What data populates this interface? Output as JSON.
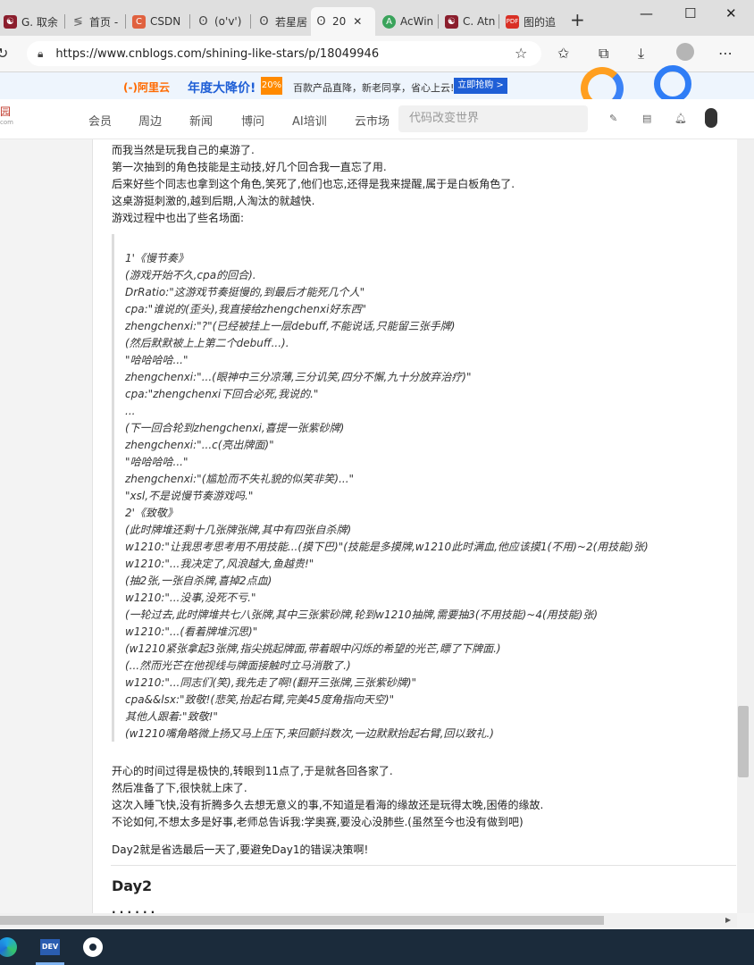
{
  "browser": {
    "tabs": [
      {
        "label": "G. 取余"
      },
      {
        "label": "首页 -"
      },
      {
        "label": "CSDN"
      },
      {
        "label": "(o'v')"
      },
      {
        "label": "若星居"
      },
      {
        "label": "20"
      },
      {
        "label": "AcWin"
      },
      {
        "label": "C. Atn"
      },
      {
        "label": "图的追"
      }
    ],
    "url": "https://www.cnblogs.com/shining-like-stars/p/18049946"
  },
  "banner": {
    "brand": "(-)阿里云",
    "sale": "年度大降价!",
    "badge": "20%",
    "slogan": "百款产品直降，新老同享，省心上云!",
    "cta": "立即抢购 >"
  },
  "site": {
    "logo": "园",
    "logo_sub": "com",
    "nav": [
      "会员",
      "周边",
      "新闻",
      "博问",
      "AI培训",
      "云市场"
    ],
    "search_placeholder": "代码改变世界"
  },
  "article": {
    "intro": [
      "而我当然是玩我自己的桌游了.",
      "第一次抽到的角色技能是主动技,好几个回合我一直忘了用.",
      "后来好些个同志也拿到这个角色,笑死了,他们也忘,还得是我来提醒,属于是白板角色了.",
      "这桌游挺刺激的,越到后期,人淘汰的就越快.",
      "游戏过程中也出了些名场面:"
    ],
    "quote": [
      "1'《慢节奏》",
      "(游戏开始不久,cpa的回合).",
      "DrRatio:\"这游戏节奏挺慢的,到最后才能死几个人\"",
      "cpa:\"谁说的(歪头),我直接给zhengchenxi好东西\"",
      "zhengchenxi:\"?\"(已经被挂上一层debuff,不能说话,只能留三张手牌)",
      "(然后默默被上上第二个debuff...).",
      "\"哈哈哈哈...\"",
      "zhengchenxi:\"...(眼神中三分凉薄,三分讥笑,四分不懈,九十分放弃治疗)\"",
      "cpa:\"zhengchenxi下回合必死,我说的.\"",
      "...",
      "(下一回合轮到zhengchenxi,喜提一张紫砂牌)",
      "zhengchenxi:\"...c(亮出牌面)\"",
      "\"哈哈哈哈...\"",
      "zhengchenxi:\"(尴尬而不失礼貌的似笑非笑)...\"",
      "\"xsl,不是说慢节奏游戏吗.\"",
      "2'《致敬》",
      "(此时牌堆还剩十几张牌张牌,其中有四张自杀牌)",
      "w1210:\"让我思考思考用不用技能...(摸下巴)\"(技能是多摸牌,w1210此时满血,他应该摸1(不用)~2(用技能)张)",
      "w1210:\"...我决定了,风浪越大,鱼越贵!\"",
      "(抽2张,一张自杀牌,喜掉2点血)",
      "w1210:\"...没事,没死不亏.\"",
      "(一轮过去,此时牌堆共七八张牌,其中三张紫砂牌,轮到w1210抽牌,需要抽3(不用技能)~4(用技能)张)",
      "w1210:\"...(看着牌堆沉思)\"",
      "(w1210紧张拿起3张牌,指尖挑起牌面,带着眼中闪烁的希望的光芒,瞟了下牌面.)",
      "(...然而光芒在他视线与牌面接触时立马消散了.)",
      "w1210:\"...同志们(笑),我先走了啊!(翻开三张牌,三张紫砂牌)\"",
      "cpa&&lsx:\"致敬!(悲笑,抬起右臂,完美45度角指向天空)\"",
      "其他人跟着:\"致敬!\"",
      "(w1210嘴角略微上扬又马上压下,来回颤抖数次,一边默默抬起右臂,回以致礼.)"
    ],
    "outro": [
      "开心的时间过得是极快的,转眼到11点了,于是就各回各家了.",
      "然后准备了下,很快就上床了.",
      "这次入睡飞快,没有折腾多久去想无意义的事,不知道是看海的缘故还是玩得太晚,困倦的缘故.",
      "不论如何,不想太多是好事,老师总告诉我:学奥赛,要没心没肺些.(虽然至今也没有做到吧)"
    ],
    "day2_note": "Day2就是省选最后一天了,要避免Day1的错误决策啊!",
    "heading": "Day2"
  },
  "colors": {
    "accent": "#1f5fd6",
    "brand_orange": "#ff6a00",
    "taskbar": "#1b2b3b"
  }
}
